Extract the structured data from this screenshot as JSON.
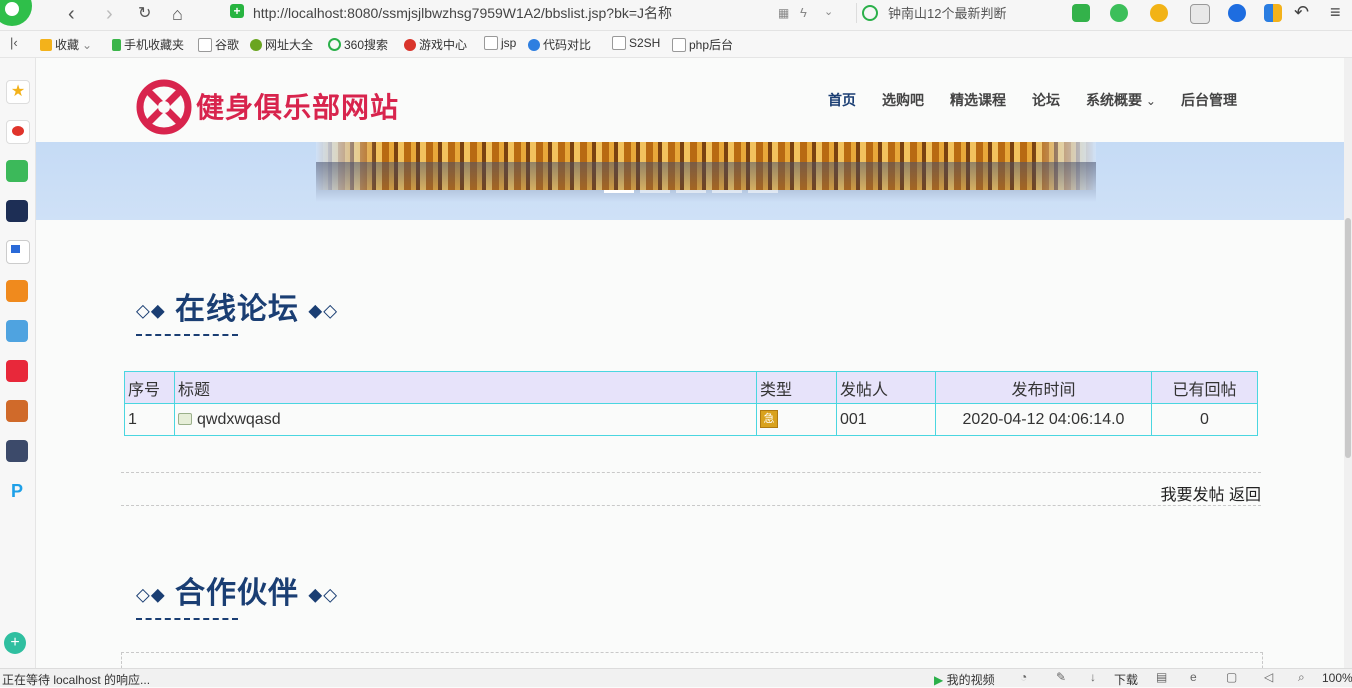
{
  "browser": {
    "url": "http://localhost:8080/ssmjsjlbwzhsg7959W1A2/bbslist.jsp?bk=J名称",
    "search_text": "钟南山12个最新判断",
    "bookmarks": [
      "收藏",
      "手机收藏夹",
      "谷歌",
      "网址大全",
      "360搜索",
      "游戏中心",
      "jsp",
      "代码对比",
      "S2SH",
      "php后台"
    ],
    "status_text": "正在等待 localhost 的响应...",
    "status_right": {
      "video": "我的视频",
      "download": "下载",
      "zoom": "100%"
    }
  },
  "site": {
    "name": "健身俱乐部网站",
    "nav": [
      "首页",
      "选购吧",
      "精选课程",
      "论坛",
      "系统概要",
      "后台管理"
    ],
    "nav_dropdown_glyph": "⌄"
  },
  "forum": {
    "title": "在线论坛",
    "columns": [
      "序号",
      "标题",
      "类型",
      "发帖人",
      "发布时间",
      "已有回帖"
    ],
    "rows": [
      {
        "index": "1",
        "title": "qwdxwqasd",
        "type_icon": "急",
        "author": "001",
        "time": "2020-04-12 04:06:14.0",
        "replies": "0"
      }
    ],
    "actions": {
      "post": "我要发帖",
      "back": "返回"
    }
  },
  "partners": {
    "title": "合作伙伴"
  },
  "colors": {
    "brand_red": "#d8244d",
    "navy": "#1a3e73",
    "table_border": "#4ad6e0",
    "table_header_bg": "#e7e3fa"
  }
}
